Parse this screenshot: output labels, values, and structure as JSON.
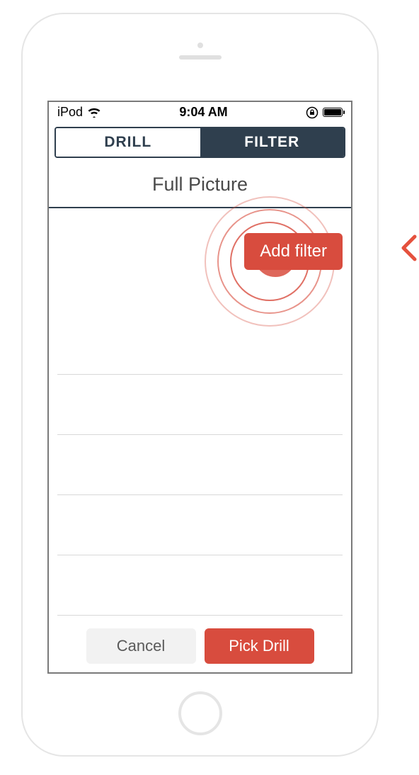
{
  "status_bar": {
    "carrier": "iPod",
    "time": "9:04 AM"
  },
  "segmented": {
    "drill_label": "DRILL",
    "filter_label": "FILTER"
  },
  "title": "Full Picture",
  "add_filter_label": "Add filter",
  "bottom": {
    "cancel_label": "Cancel",
    "pick_label": "Pick Drill"
  }
}
